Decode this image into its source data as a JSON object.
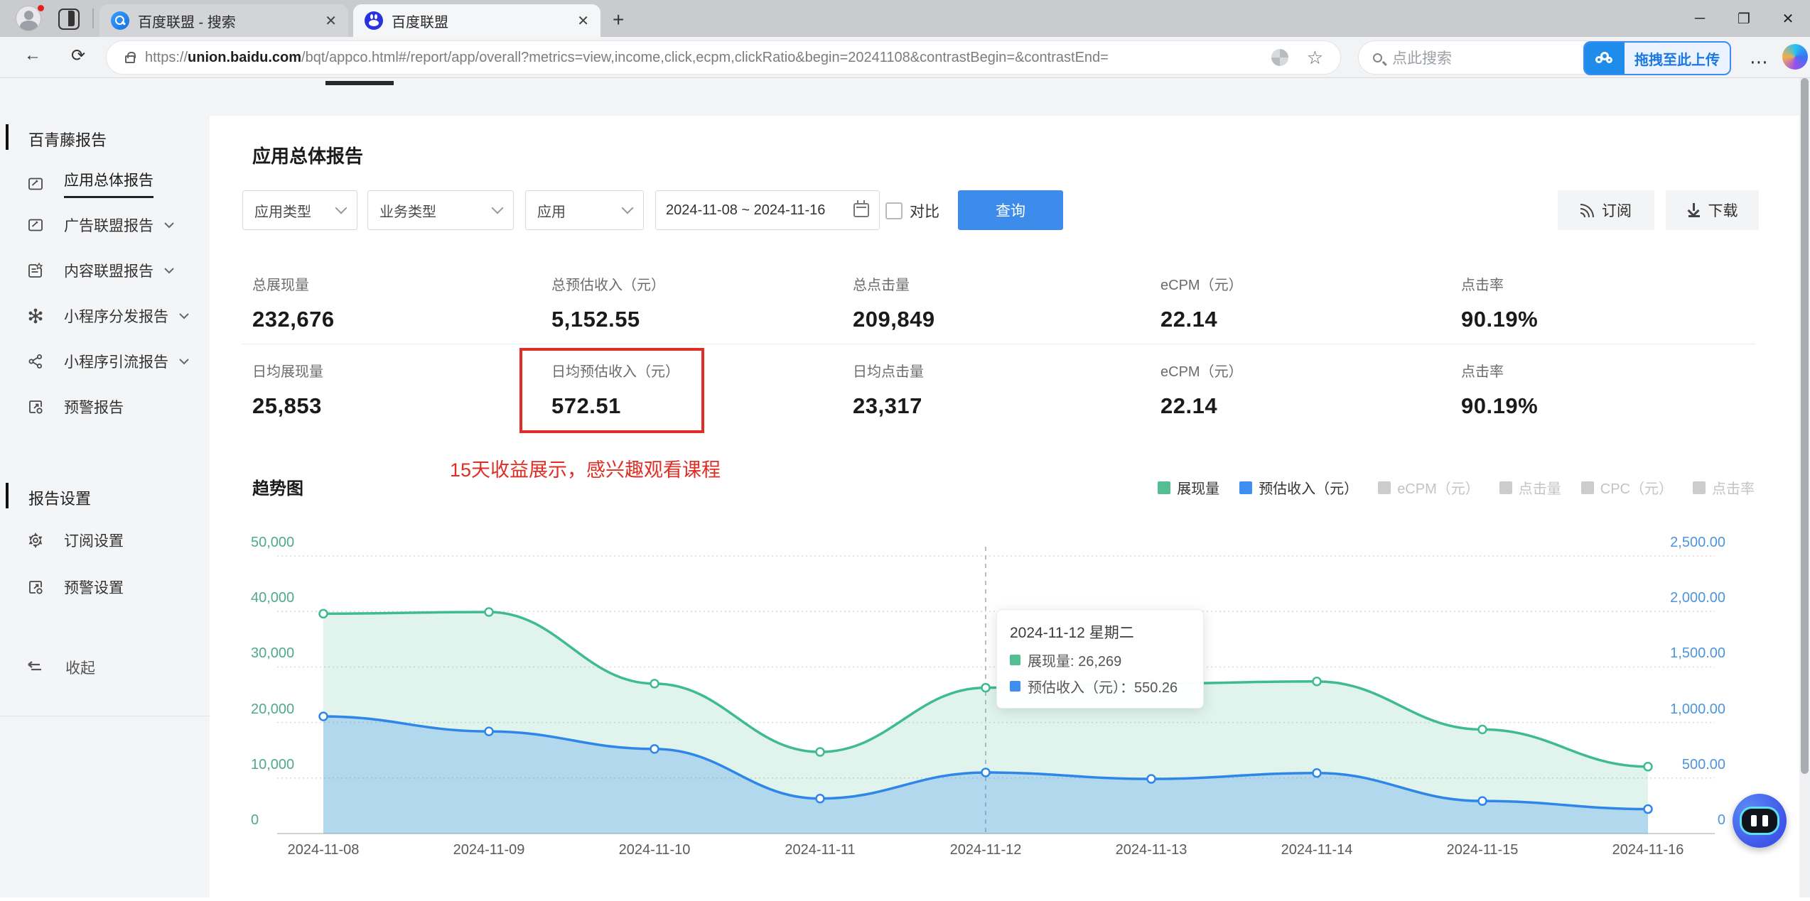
{
  "browser": {
    "tabs": [
      {
        "title": "百度联盟 - 搜索"
      },
      {
        "title": "百度联盟"
      }
    ],
    "url_scheme": "https://",
    "url_host": "union.baidu.com",
    "url_rest": "/bqt/appco.html#/report/app/overall?metrics=view,income,click,ecpm,clickRatio&begin=20241108&contrastBegin=&contrastEnd=",
    "search_placeholder": "点此搜索",
    "upload_button": "拖拽至此上传"
  },
  "sidebar": {
    "section1": "百青藤报告",
    "items": [
      {
        "label": "应用总体报告"
      },
      {
        "label": "广告联盟报告"
      },
      {
        "label": "内容联盟报告"
      },
      {
        "label": "小程序分发报告"
      },
      {
        "label": "小程序引流报告"
      },
      {
        "label": "预警报告"
      }
    ],
    "section2": "报告设置",
    "settings": [
      {
        "label": "订阅设置"
      },
      {
        "label": "预警设置"
      }
    ],
    "collapse": "收起"
  },
  "main": {
    "title": "应用总体报告",
    "filters": {
      "app_type": "应用类型",
      "biz_type": "业务类型",
      "app": "应用",
      "date_range": "2024-11-08 ~ 2024-11-16",
      "compare": "对比",
      "query": "查询",
      "subscribe": "订阅",
      "download": "下载"
    },
    "stats": {
      "r1": [
        {
          "label": "总展现量",
          "value": "232,676"
        },
        {
          "label": "总预估收入（元）",
          "value": "5,152.55"
        },
        {
          "label": "总点击量",
          "value": "209,849"
        },
        {
          "label": "eCPM（元）",
          "value": "22.14"
        },
        {
          "label": "点击率",
          "value": "90.19%"
        }
      ],
      "r2": [
        {
          "label": "日均展现量",
          "value": "25,853"
        },
        {
          "label": "日均预估收入（元）",
          "value": "572.51"
        },
        {
          "label": "日均点击量",
          "value": "23,317"
        },
        {
          "label": "eCPM（元）",
          "value": "22.14"
        },
        {
          "label": "点击率",
          "value": "90.19%"
        }
      ]
    },
    "annotation": "15天收益展示，感兴趣观看课程"
  },
  "chart_data": {
    "type": "area",
    "title": "趋势图",
    "x": [
      "2024-11-08",
      "2024-11-09",
      "2024-11-10",
      "2024-11-11",
      "2024-11-12",
      "2024-11-13",
      "2024-11-14",
      "2024-11-15",
      "2024-11-16"
    ],
    "series": [
      {
        "name": "展现量",
        "axis": "left",
        "color": "#52be92",
        "line": "#3fbc8d",
        "fill": "rgba(63,188,141,0.16)",
        "values": [
          39600,
          39900,
          27000,
          14700,
          26269,
          27000,
          27400,
          18750,
          12050
        ]
      },
      {
        "name": "预估收入（元）",
        "axis": "right",
        "color": "#3d8ef0",
        "line": "#2e86e8",
        "fill": "rgba(62,142,240,0.28)",
        "values": [
          1055,
          920,
          762,
          315,
          550.26,
          492,
          545,
          293,
          220.29
        ]
      }
    ],
    "legend_inactive": [
      "eCPM（元）",
      "点击量",
      "CPC（元）",
      "点击率"
    ],
    "left_axis": {
      "min": 0,
      "max": 50000,
      "ticks": [
        "0",
        "10,000",
        "20,000",
        "30,000",
        "40,000",
        "50,000"
      ]
    },
    "right_axis": {
      "min": 0,
      "max": 2500,
      "ticks": [
        "0",
        "500.00",
        "1,000.00",
        "1,500.00",
        "2,000.00",
        "2,500.00"
      ]
    },
    "grid": true,
    "legend_position": "top-right",
    "hover_index": 4,
    "tooltip": {
      "title": "2024-11-12 星期二",
      "rows": [
        {
          "text": "展现量: 26,269",
          "color": "#52be92"
        },
        {
          "text": "预估收入（元）：550.26",
          "color": "#3d8ef0"
        }
      ]
    }
  }
}
